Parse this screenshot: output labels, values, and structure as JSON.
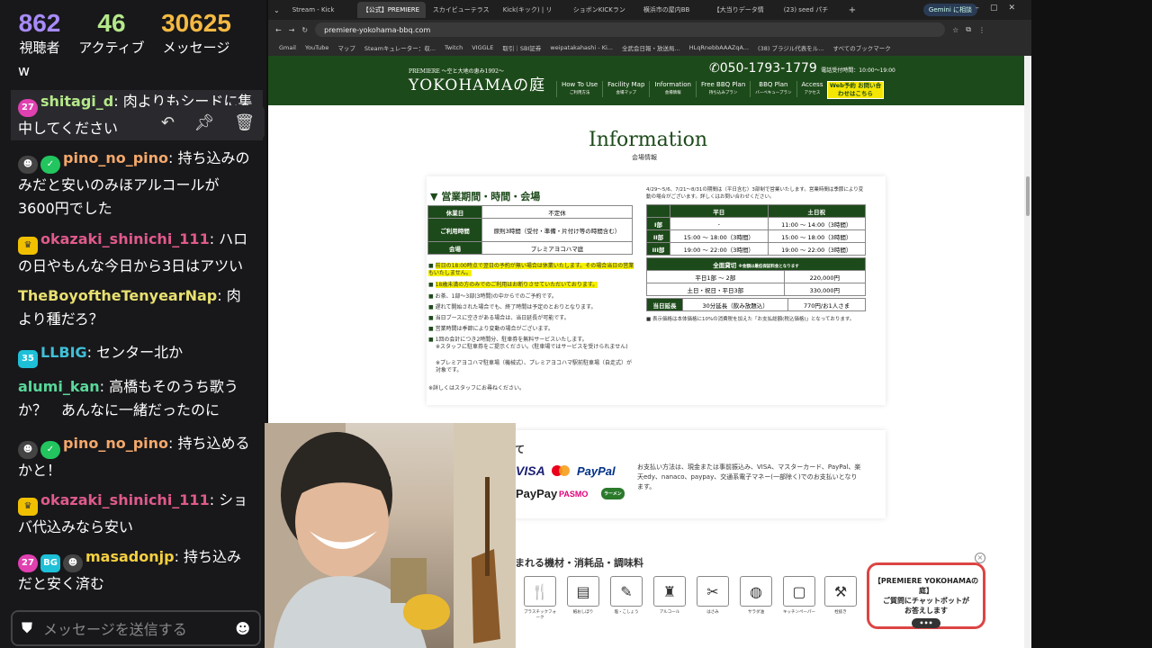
{
  "stats": [
    {
      "value": "862",
      "label": "視聴者",
      "color": "#a78bfa"
    },
    {
      "value": "46",
      "label": "アクティブ",
      "color": "#b5e88a"
    },
    {
      "value": "30625",
      "label": "メッセージ",
      "color": "#f5b942"
    }
  ],
  "chat": {
    "partial_top": "w",
    "messages": [
      {
        "user": "shitagi_d",
        "user_color": "#b5e88a",
        "text": ": 肉よりもシードに集中してください"
      },
      {
        "user": "pino_no_pino",
        "user_color": "#f5a86a",
        "text": ": 持ち込みのみだと安いのみほアルコールが3600円でした"
      },
      {
        "user": "okazaki_shinichi_111",
        "user_color": "#e05a8a",
        "text": ": ハロの日やもんな今日から3日はアツい"
      },
      {
        "user": "TheBoyoftheTenyearNap",
        "user_color": "#e8e070",
        "text": ": 肉より種だろ？"
      },
      {
        "user": "LLBIG",
        "user_color": "#40c0d8",
        "text": ": センター北か"
      },
      {
        "user": "alumi_kan",
        "user_color": "#5ad89a",
        "text": ": 高橋もそのうち歌うか？　あんなに一緒だったのに"
      },
      {
        "user": "pino_no_pino",
        "user_color": "#f5a86a",
        "text": ": 持ち込めるかと！"
      },
      {
        "user": "okazaki_shinichi_111",
        "user_color": "#e05a8a",
        "text": ": ショバ代込みなら安い"
      },
      {
        "user": "masadonjp",
        "user_color": "#f5d040",
        "text": ": 持ち込みだと安く済む"
      }
    ],
    "badges": {
      "b27": "27",
      "b35": "35",
      "bg": "BG"
    },
    "input_placeholder": "メッセージを送信する",
    "hover_icons": [
      "reply-icon",
      "pin-icon",
      "delete-icon"
    ]
  },
  "browser": {
    "tabs": [
      "Stream - Kick",
      "【公式】PREMIERE",
      "スカイビューテラス",
      "Kick(キック) | リ",
      "ショボンKICKラン",
      "横浜市の屋内BB",
      "【大当りデータ情",
      "(23) seed パチ"
    ],
    "gemini": "Gemini に相談",
    "url": "premiere-yokohama-bbq.com",
    "bookmarks": [
      "Gmail",
      "YouTube",
      "マップ",
      "Steamキュレーター：収...",
      "Twitch",
      "VIGGLE",
      "取引｜SBI証券",
      "weipatakahashi - Ki...",
      "全武会日報・放送局...",
      "HLqRnebbAAAZqA...",
      "(38) ブラジル代表をル...",
      "すべてのブックマーク"
    ]
  },
  "site": {
    "logo_small": "PREMIERE 〜空と大地の恵み1992〜",
    "logo_big": "YOKOHAMAの庭",
    "phone": "050-1793-1779",
    "phone_hours": "電話受付時間：10:00～19:00",
    "nav": [
      {
        "en": "How To Use",
        "jp": "ご利用方法"
      },
      {
        "en": "Facility Map",
        "jp": "会場マップ"
      },
      {
        "en": "Information",
        "jp": "会場情報"
      },
      {
        "en": "Free BBQ Plan",
        "jp": "持ち込みプラン"
      },
      {
        "en": "BBQ Plan",
        "jp": "バーベキュープラン"
      },
      {
        "en": "Access",
        "jp": "アクセス"
      }
    ],
    "web_btn": "Web予約 お問い合わせはこちら",
    "info_title": "Information",
    "info_sub": "会場情報",
    "card1_title": "営業期間・時間・会場",
    "hours_table": [
      [
        "休業日",
        "不定休"
      ],
      [
        "ご利用時間",
        "原則3時間（受付・準備・片付け等の時間含む）"
      ],
      [
        "会場",
        "プレミアヨコハマ庭"
      ]
    ],
    "bullets": [
      "前日の18:00時点で翌日の予約が無い場合は休業いたします。その場合当日の営業もいたしません。",
      "18歳未満の方のみでのご利用はお断りさせていただいております。",
      "お茶、1部～3部(3時間)の中からでのご予約です。",
      "遅れて開始された場合でも、終了時間は予定のとおりとなります。",
      "当日ブースに空きがある場合は、当日延長が可能です。",
      "営業時間は季節により変動の場合がございます。",
      "1回の会計につき2時間分、駐車券を無料サービスいたします。",
      "※スタッフに駐車券をご提示ください。(駐車場ではサービスを受けられません)",
      "※プレミアヨコハマ駐車場（機械式）、プレミアヨコハマ駅前駐車場（自走式）が対象です。",
      "※詳しくはスタッフにお尋ねください。"
    ],
    "note_top": "4/29～5/6、7/21～8/31の期間は（平日含む）3部制で営業いたします。営業時間は季節により変動の場合がございます。詳しくはお問い合わせください。",
    "schedule": {
      "headers": [
        "",
        "平日",
        "土日祝"
      ],
      "rows": [
        [
          "I部",
          "-",
          "11:00 ～ 14:00（3時間）"
        ],
        [
          "II部",
          "15:00 ～ 18:00（3時間）",
          "15:00 ～ 18:00（3時間）"
        ],
        [
          "III部",
          "19:00 ～ 22:00（3時間）",
          "19:00 ～ 22:00（3時間）"
        ]
      ]
    },
    "rental": {
      "header": "全面貸切",
      "header_note": "※金額は最低保証料金となります",
      "rows": [
        [
          "平日1部 ～ 2部",
          "220,000円"
        ],
        [
          "土日・祝日・平日3部",
          "330,000円"
        ]
      ]
    },
    "extension": {
      "label": "当日延長",
      "desc": "30分延長（飲み放題込）",
      "price": "770円/お1人さま"
    },
    "tax_note": "表示価格は本体価格に10%の消費税を加えた「お支払総額(税込価格)」となっております。",
    "card2_title_partial": "て",
    "payments": [
      "VISA",
      "mastercard",
      "PayPal",
      "PayPay",
      "PASMO",
      "ラーメン"
    ],
    "payment_note": "お支払い方法は、現金または事前振込み、VISA、マスターカード、PayPal、楽天edy、nanaco、paypay、交通系電子マネー(一部除く)でのお支払いとなります。",
    "card3_title": "まれる機材・消耗品・調味料",
    "equipment": [
      {
        "icon": "🍴",
        "cap": "プラスチックフォーク",
        "name": "fork-icon"
      },
      {
        "icon": "▤",
        "cap": "紙おしぼり",
        "name": "towel-icon"
      },
      {
        "icon": "✎",
        "cap": "塩・こしょう",
        "name": "salt-icon"
      },
      {
        "icon": "♜",
        "cap": "アルコール",
        "name": "alcohol-icon"
      },
      {
        "icon": "✂",
        "cap": "はさみ",
        "name": "scissors-icon"
      },
      {
        "icon": "◍",
        "cap": "サラダ油",
        "name": "oil-icon"
      },
      {
        "icon": "▢",
        "cap": "キッチンペーパー",
        "name": "paper-icon"
      },
      {
        "icon": "⚒",
        "cap": "栓抜き",
        "name": "opener-icon"
      }
    ],
    "chatbot": [
      "【PREMIERE YOKOHAMAの庭】",
      "ご質問にチャットボットが",
      "お答えします"
    ]
  }
}
